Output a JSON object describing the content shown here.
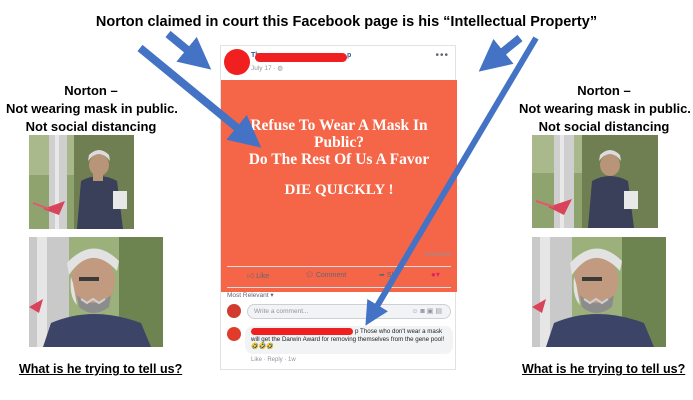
{
  "headline": "Norton claimed in court this Facebook page is his “Intellectual Property”",
  "left_caption": {
    "line1": "Norton –",
    "line2": "Not wearing mask in public.",
    "line3": "Not social distancing"
  },
  "right_caption": {
    "line1": "Norton –",
    "line2": "Not wearing mask in public.",
    "line3": "Not social distancing"
  },
  "left_question": "What is he trying to tell us?",
  "right_question": "What is he trying to tell us?",
  "post": {
    "page_name_start": "The",
    "page_name_end": "p",
    "timestamp": "July 17 · ◍",
    "more_icon": "more-dots-icon",
    "banner": {
      "line1": "Refuse To Wear A Mask In",
      "line2": "Public?",
      "line3": "Do The Rest Of Us A Favor",
      "line4": "DIE QUICKLY !",
      "color": "#f56547"
    },
    "comments_count": "omments",
    "actions": {
      "like": "Like",
      "comment": "Comment",
      "share": "Sh"
    },
    "most_relevant": "Most Relevant ▾",
    "comment_placeholder": "Write a comment...",
    "comment_text": "p Those who don't wear a mask will get the Darwin Award for removing themselves from the gene pool! 🤣🤣🤣",
    "comment_meta": "Like · Reply · 1w"
  },
  "colors": {
    "redaction": "#f02020",
    "arrow": "#4472c4",
    "link_blue": "#385898"
  }
}
